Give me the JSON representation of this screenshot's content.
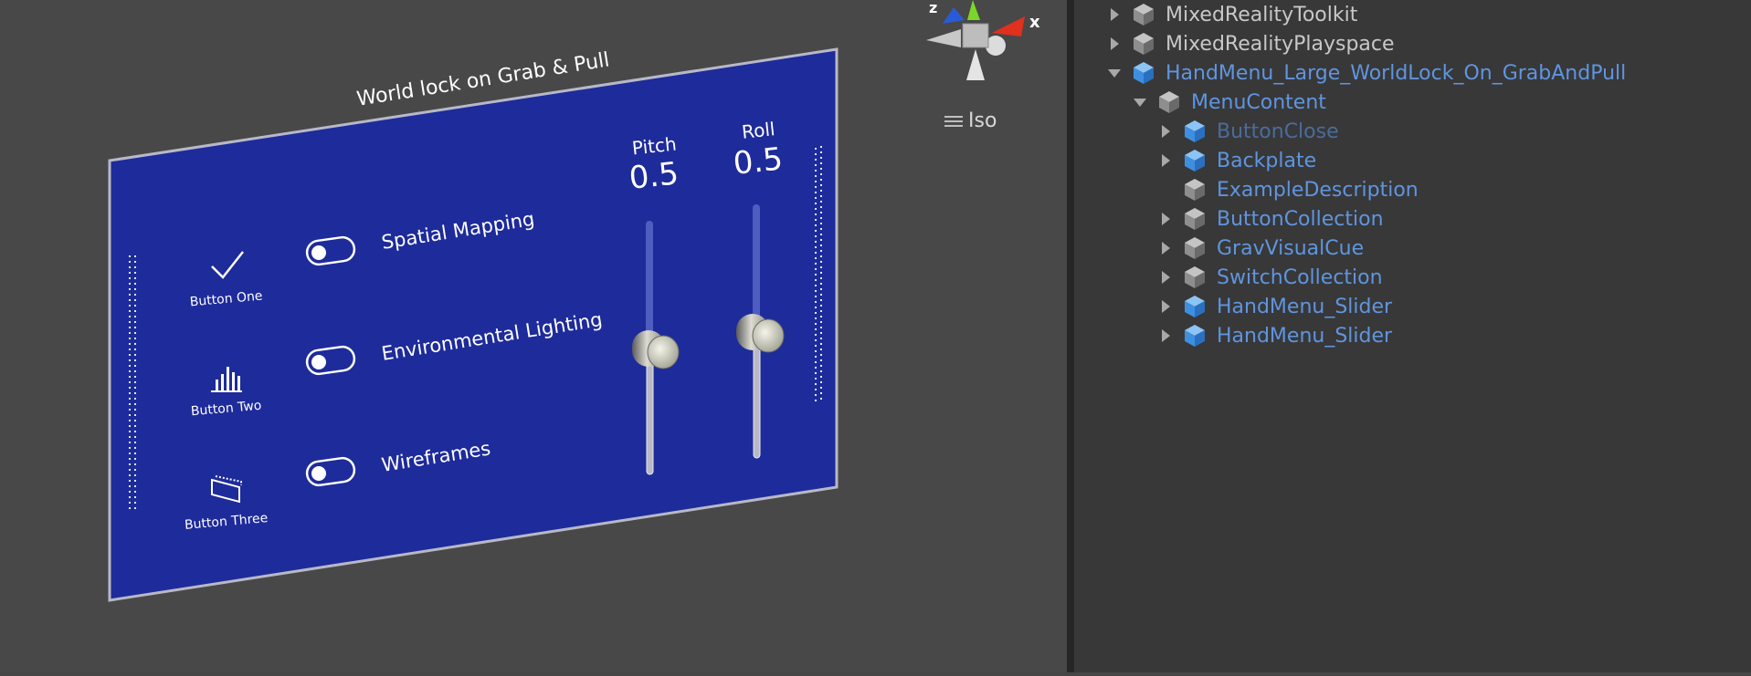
{
  "scene": {
    "panel_title": "World lock on Grab & Pull",
    "buttons": [
      {
        "label": "Button One",
        "icon": "checkmark-icon"
      },
      {
        "label": "Button Two",
        "icon": "bar-chart-icon"
      },
      {
        "label": "Button Three",
        "icon": "frame-icon"
      }
    ],
    "switches": [
      {
        "label": "Spatial Mapping",
        "on": false
      },
      {
        "label": "Environmental Lighting",
        "on": false
      },
      {
        "label": "Wireframes",
        "on": false
      }
    ],
    "sliders": [
      {
        "label": "Pitch",
        "value_text": "0.5",
        "value": 0.5
      },
      {
        "label": "Roll",
        "value_text": "0.5",
        "value": 0.5
      }
    ],
    "gizmo": {
      "axis_x": "x",
      "axis_z": "z",
      "view_mode": "Iso"
    },
    "colors": {
      "panel": "#1e2b9a",
      "background": "#484848",
      "axis_x": "#e0301e",
      "axis_y": "#7bd62a",
      "axis_z": "#2a5bd6"
    }
  },
  "hierarchy": {
    "items": [
      {
        "label": "MixedRealityToolkit",
        "expanded": false,
        "style": "normal",
        "icon": "gameobject-cube-icon"
      },
      {
        "label": "MixedRealityPlayspace",
        "expanded": false,
        "style": "normal",
        "icon": "gameobject-cube-icon"
      },
      {
        "label": "HandMenu_Large_WorldLock_On_GrabAndPull",
        "expanded": true,
        "style": "prefab",
        "icon": "prefab-cube-icon"
      },
      {
        "label": "MenuContent",
        "expanded": true,
        "style": "prefab",
        "icon": "gameobject-cube-icon"
      },
      {
        "label": "ButtonClose",
        "expanded": false,
        "style": "inactive",
        "icon": "prefab-cube-icon"
      },
      {
        "label": "Backplate",
        "expanded": false,
        "style": "prefab",
        "icon": "prefab-cube-icon"
      },
      {
        "label": "ExampleDescription",
        "expanded": null,
        "style": "prefab",
        "icon": "gameobject-cube-icon"
      },
      {
        "label": "ButtonCollection",
        "expanded": false,
        "style": "prefab",
        "icon": "gameobject-cube-icon"
      },
      {
        "label": "GravVisualCue",
        "expanded": false,
        "style": "prefab",
        "icon": "gameobject-cube-icon"
      },
      {
        "label": "SwitchCollection",
        "expanded": false,
        "style": "prefab",
        "icon": "gameobject-cube-icon"
      },
      {
        "label": "HandMenu_Slider",
        "expanded": false,
        "style": "prefab",
        "icon": "prefab-cube-icon"
      },
      {
        "label": "HandMenu_Slider",
        "expanded": false,
        "style": "prefab",
        "icon": "prefab-cube-icon"
      }
    ]
  }
}
